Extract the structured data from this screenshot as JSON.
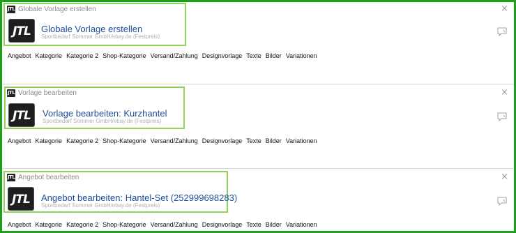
{
  "panels": [
    {
      "window_title": "Globale Vorlage erstellen",
      "logo_text": "JTL",
      "title": "Globale Vorlage erstellen",
      "subtitle": "Sportbedarf Sommer GmbH/ebay.de (Festpreis)",
      "tabs": [
        "Angebot",
        "Kategorie",
        "Kategorie 2",
        "Shop-Kategorie",
        "Versand/Zahlung",
        "Designvorlage",
        "Texte",
        "Bilder",
        "Variationen"
      ]
    },
    {
      "window_title": "Vorlage bearbeiten",
      "logo_text": "JTL",
      "title": "Vorlage bearbeiten: Kurzhantel",
      "subtitle": "Sportbedarf Sommer GmbH/ebay.de (Festpreis)",
      "tabs": [
        "Angebot",
        "Kategorie",
        "Kategorie 2",
        "Shop-Kategorie",
        "Versand/Zahlung",
        "Designvorlage",
        "Texte",
        "Bilder",
        "Variationen"
      ]
    },
    {
      "window_title": "Angebot bearbeiten",
      "logo_text": "JTL",
      "title": "Angebot bearbeiten: Hantel-Set (252999698283)",
      "subtitle": "Sportbedarf Sommer GmbH/ebay.de (Festpreis)",
      "tabs": [
        "Angebot",
        "Kategorie",
        "Kategorie 2",
        "Shop-Kategorie",
        "Versand/Zahlung",
        "Designvorlage",
        "Texte",
        "Bilder",
        "Variationen"
      ]
    }
  ],
  "close_symbol": "×",
  "icons": {
    "close": "close-icon",
    "comment": "comment-icon",
    "logo": "jtl-logo-icon"
  },
  "colors": {
    "frame": "#1fa01c",
    "highlight": "#8fd35a",
    "title": "#1f4f9c"
  }
}
